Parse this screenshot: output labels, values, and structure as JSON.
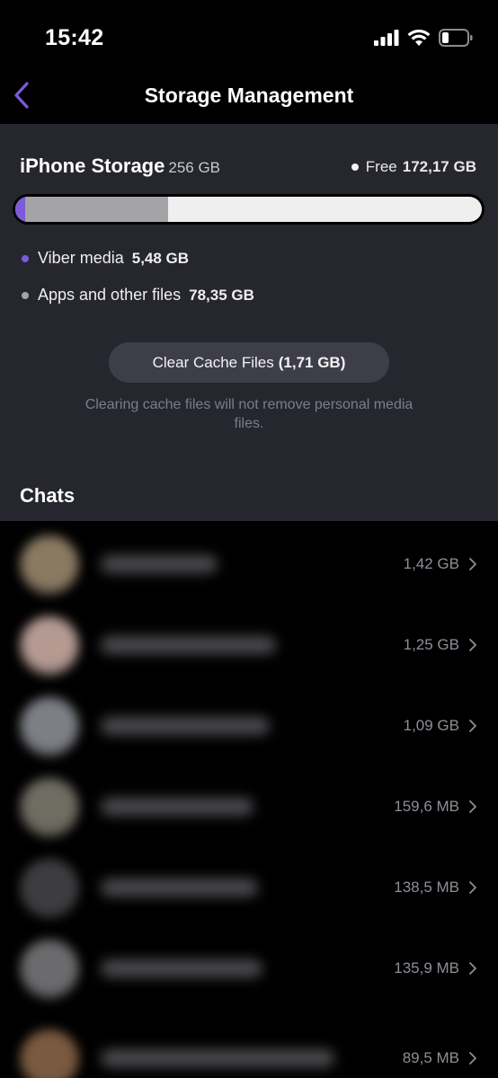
{
  "status_bar": {
    "time": "15:42",
    "icons": [
      "signal-icon",
      "wifi-icon",
      "battery-icon"
    ]
  },
  "nav": {
    "title": "Storage Management",
    "back_icon": "chevron-left-icon"
  },
  "storage": {
    "title": "iPhone Storage",
    "total": "256 GB",
    "free_label": "Free",
    "free_value": "172,17 GB",
    "usage": {
      "viber_fraction": 0.021,
      "apps_fraction": 0.306
    },
    "legend": [
      {
        "label": "Viber media",
        "value": "5,48 GB",
        "color": "#7b5bd9"
      },
      {
        "label": "Apps and other files",
        "value": "78,35 GB",
        "color": "#a4a4a6"
      }
    ],
    "clear_button_label": "Clear Cache Files",
    "clear_button_size": "(1,71 GB)",
    "cache_note": "Clearing cache files will not remove personal media files."
  },
  "chats": {
    "heading": "Chats",
    "items": [
      {
        "size": "1,42 GB",
        "avatar_color": "#8a7a62"
      },
      {
        "size": "1,25 GB",
        "avatar_color": "#b59a92"
      },
      {
        "size": "1,09 GB",
        "avatar_color": "#7d7f86"
      },
      {
        "size": "159,6 MB",
        "avatar_color": "#6f6c62"
      },
      {
        "size": "138,5 MB",
        "avatar_color": "#3d3d40"
      },
      {
        "size": "135,9 MB",
        "avatar_color": "#6b6b6d"
      },
      {
        "size": "89,5 MB",
        "avatar_color": "#7a5a40"
      }
    ]
  },
  "colors": {
    "accent": "#7b5bd9",
    "panel_bg": "#26262f",
    "page_bg": "#000000"
  }
}
